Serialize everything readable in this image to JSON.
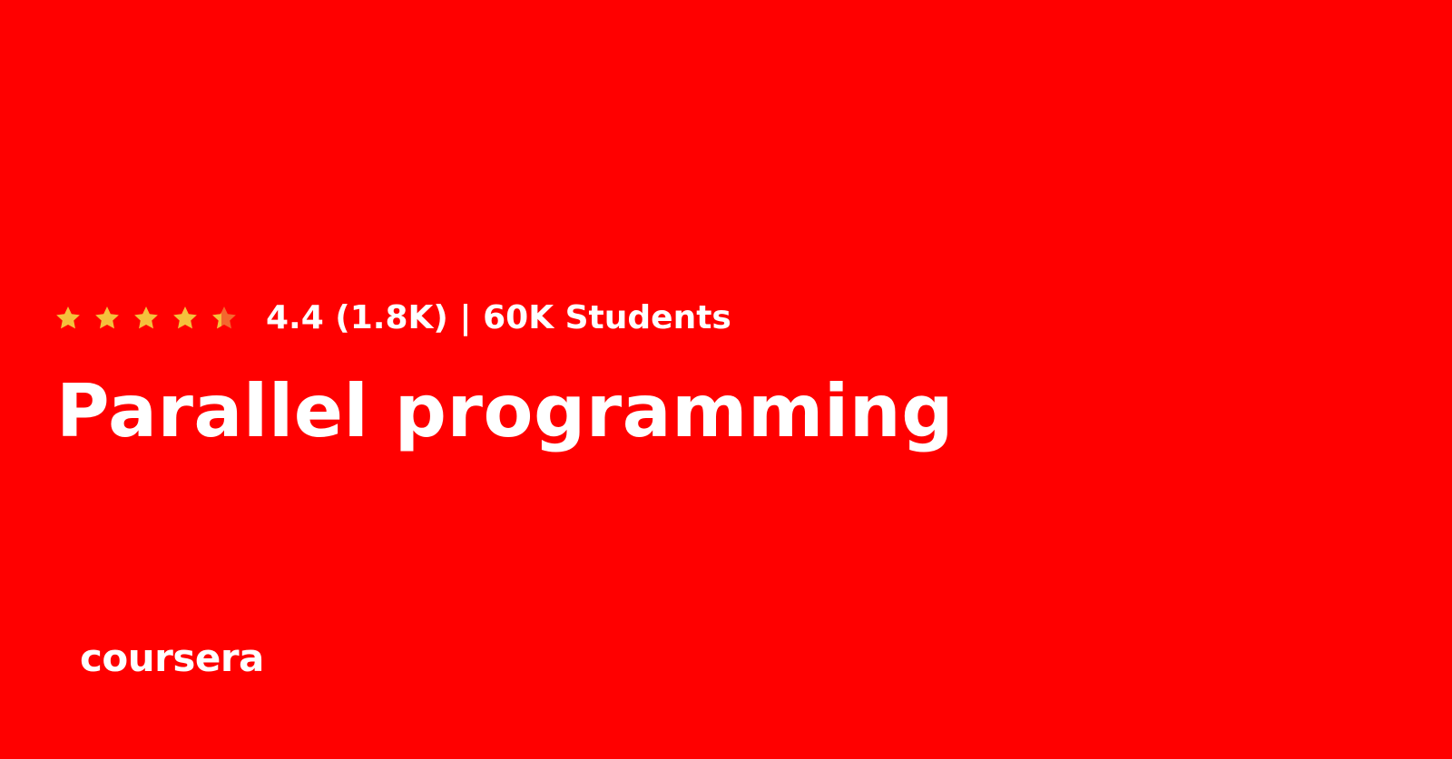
{
  "course": {
    "rating": {
      "stars_filled": 4.4,
      "stars_max": 5,
      "summary": "4.4 (1.8K) | 60K Students"
    },
    "title": "Parallel programming"
  },
  "brand": {
    "logo_text": "coursera"
  },
  "colors": {
    "background": "#ff0000",
    "text": "#ffffff",
    "star_fill": "#f5c03c",
    "star_partial": "#f4672e"
  },
  "icons": {
    "rating_star": "star-icon"
  }
}
